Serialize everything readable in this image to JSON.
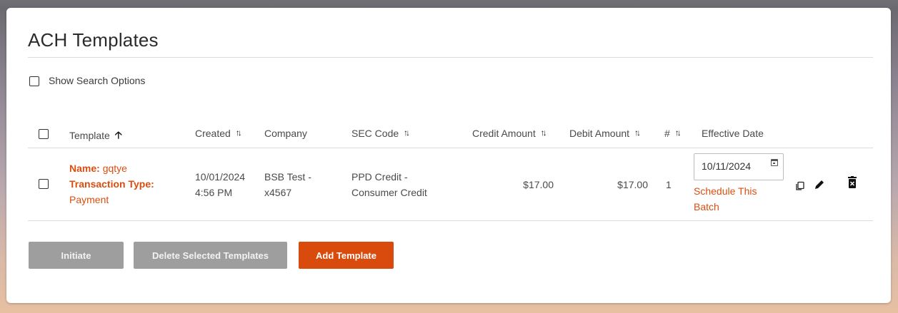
{
  "page": {
    "title": "ACH Templates"
  },
  "search": {
    "show_options_label": "Show Search Options"
  },
  "table": {
    "headers": {
      "template": "Template",
      "created": "Created",
      "company": "Company",
      "sec_code": "SEC Code",
      "credit_amount": "Credit Amount",
      "debit_amount": "Debit Amount",
      "count": "#",
      "effective_date": "Effective Date"
    },
    "rows": [
      {
        "name_label": "Name:",
        "name_value": "gqtye",
        "transaction_type_label": "Transaction Type:",
        "transaction_type_value": "Payment",
        "created_date": "10/01/2024",
        "created_time": "4:56 PM",
        "company_line1": "BSB Test -",
        "company_line2": "x4567",
        "sec_code_line1": "PPD Credit -",
        "sec_code_line2": "Consumer Credit",
        "credit_amount": "$17.00",
        "debit_amount": "$17.00",
        "count": "1",
        "effective_date": "10/11/2024",
        "schedule_line1": "Schedule This",
        "schedule_line2": "Batch"
      }
    ]
  },
  "buttons": {
    "initiate": "Initiate",
    "delete_selected": "Delete Selected Templates",
    "add_template": "Add Template"
  },
  "icons": {
    "sort_ascending": "arrow-up-icon",
    "sort_both": "sort-icon",
    "calendar": "calendar-icon",
    "copy": "copy-icon",
    "edit": "pencil-icon",
    "delete": "trash-icon"
  },
  "colors": {
    "accent": "#d94a0d",
    "disabled_button": "#9e9e9e",
    "text": "#4a4a4a"
  }
}
